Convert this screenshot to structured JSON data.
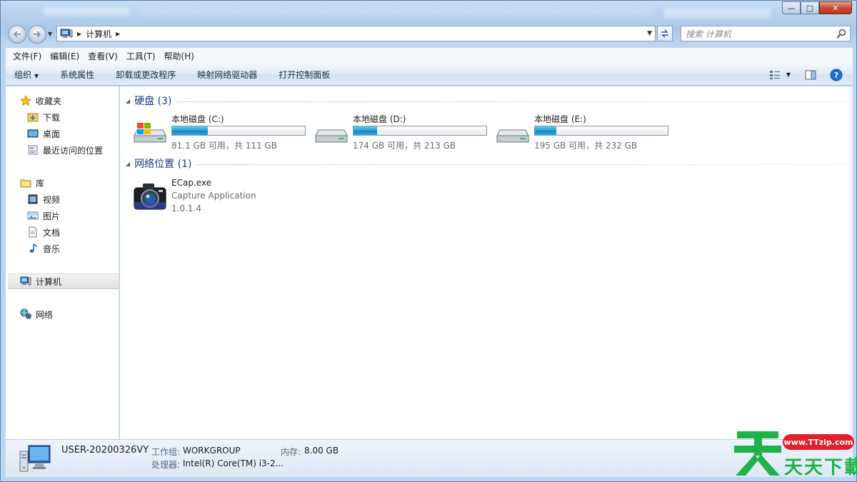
{
  "window": {
    "caption": {
      "minimize": "—",
      "maximize": "□",
      "close": "✕"
    }
  },
  "navigation": {
    "breadcrumb": [
      "计算机"
    ],
    "search_placeholder": "搜索 计算机"
  },
  "menu": [
    "文件(F)",
    "编辑(E)",
    "查看(V)",
    "工具(T)",
    "帮助(H)"
  ],
  "commands": {
    "organize": "组织",
    "system_properties": "系统属性",
    "uninstall": "卸载或更改程序",
    "map_drive": "映射网络驱动器",
    "control_panel": "打开控制面板"
  },
  "sidebar": {
    "favorites": {
      "label": "收藏夹",
      "items": [
        "下载",
        "桌面",
        "最近访问的位置"
      ]
    },
    "libraries": {
      "label": "库",
      "items": [
        "视频",
        "图片",
        "文档",
        "音乐"
      ]
    },
    "computer": "计算机",
    "network": "网络"
  },
  "content": {
    "hard_disks": {
      "title": "硬盘 (3)",
      "drives": [
        {
          "name": "本地磁盘 (C:)",
          "size": "81.1 GB 可用，共 111 GB",
          "used_fraction": 0.27
        },
        {
          "name": "本地磁盘 (D:)",
          "size": "174 GB 可用，共 213 GB",
          "used_fraction": 0.18
        },
        {
          "name": "本地磁盘 (E:)",
          "size": "195 GB 可用，共 232 GB",
          "used_fraction": 0.16
        }
      ]
    },
    "network_locations": {
      "title": "网络位置 (1)",
      "items": [
        {
          "name": "ECap.exe",
          "description": "Capture Application",
          "version": "1.0.1.4"
        }
      ]
    }
  },
  "details": {
    "computer_name": "USER-20200326VY",
    "workgroup_label": "工作组:",
    "workgroup": "WORKGROUP",
    "memory_label": "内存:",
    "memory": "8.00 GB",
    "processor_label": "处理器:",
    "processor": "Intel(R) Core(TM) i3-2..."
  },
  "watermark": {
    "url": "www.TTzip.com",
    "chars": "天天下載"
  },
  "colors": {
    "link_blue": "#1e3a8a",
    "drive_fill": "#26a0da",
    "watermark_green": "#21b14b",
    "watermark_red": "#e31f2c"
  }
}
